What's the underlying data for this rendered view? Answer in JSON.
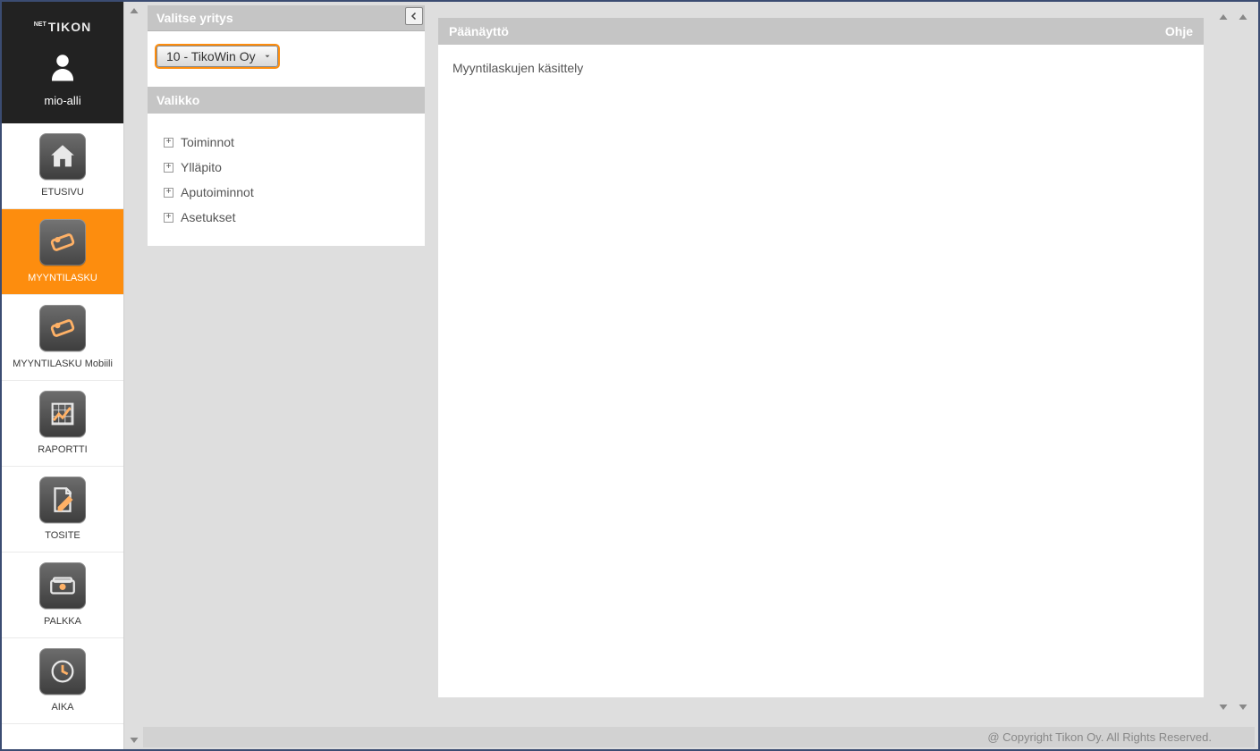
{
  "brand": {
    "prefix": "NET",
    "name": "TIKON"
  },
  "user": {
    "name": "mio-alli"
  },
  "sidebar": {
    "items": [
      {
        "label": "ETUSIVU"
      },
      {
        "label": "MYYNTILASKU"
      },
      {
        "label": "MYYNTILASKU Mobiili"
      },
      {
        "label": "RAPORTTI"
      },
      {
        "label": "TOSITE"
      },
      {
        "label": "PALKKA"
      },
      {
        "label": "AIKA"
      }
    ]
  },
  "accordion": {
    "select_company_header": "Valitse yritys",
    "selected_company": "10 - TikoWin Oy",
    "menu_header": "Valikko",
    "tree": [
      {
        "label": "Toiminnot"
      },
      {
        "label": "Ylläpito"
      },
      {
        "label": "Aputoiminnot"
      },
      {
        "label": "Asetukset"
      }
    ]
  },
  "main": {
    "title": "Päänäyttö",
    "help": "Ohje",
    "content": "Myyntilaskujen käsittely"
  },
  "footer": "@ Copyright Tikon Oy. All Rights Reserved."
}
